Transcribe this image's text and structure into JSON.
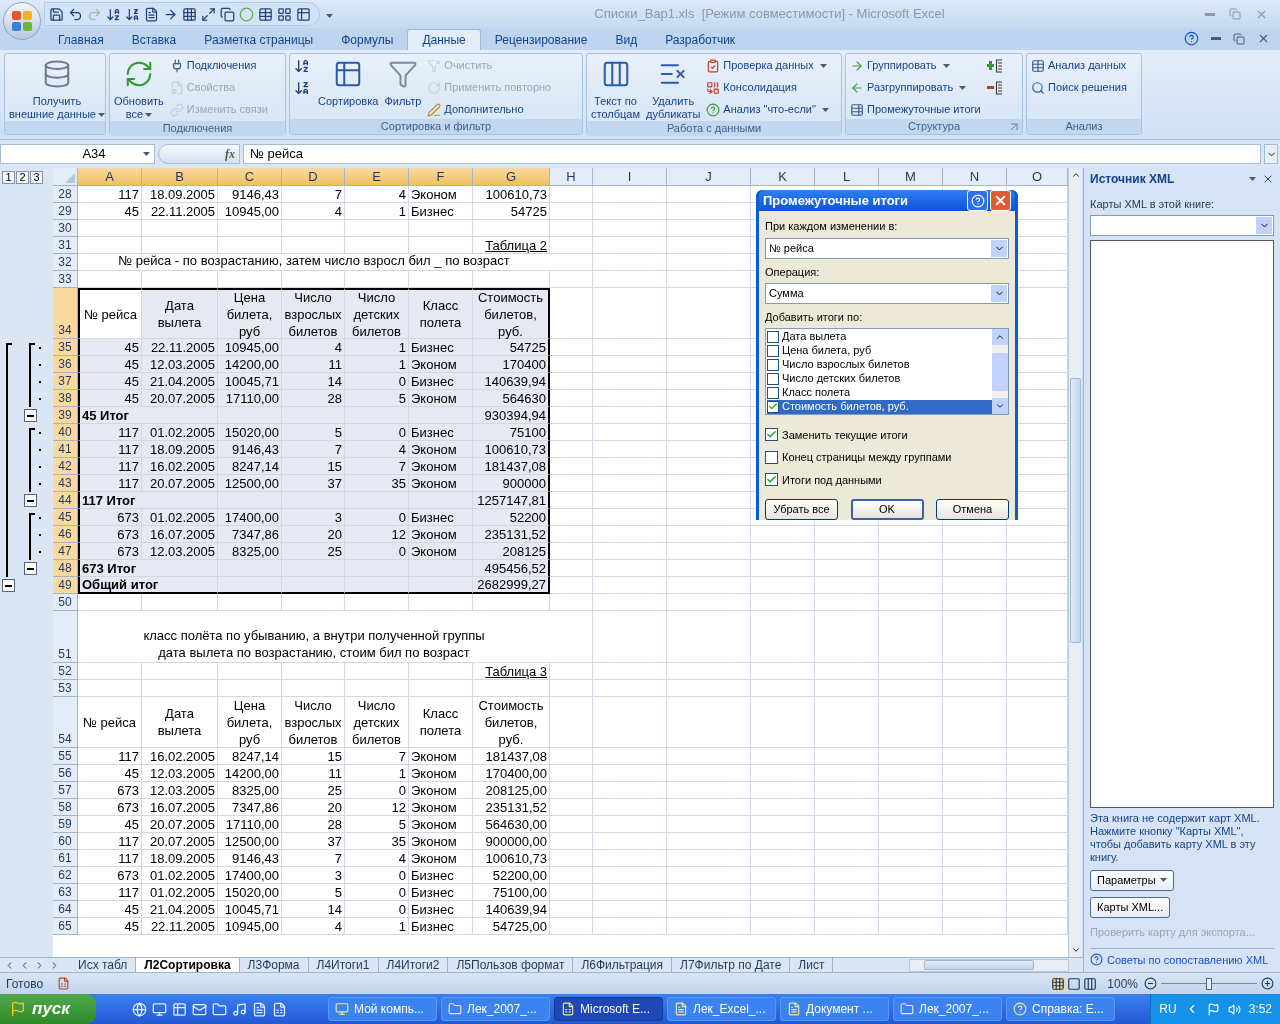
{
  "window": {
    "title": "Списки_Вар1.xls  [Режим совместимости] - Microsoft Excel"
  },
  "ribbon": {
    "tabs": [
      {
        "label": "Главная",
        "selected": false
      },
      {
        "label": "Вставка",
        "selected": false
      },
      {
        "label": "Разметка страницы",
        "selected": false
      },
      {
        "label": "Формулы",
        "selected": false
      },
      {
        "label": "Данные",
        "selected": true
      },
      {
        "label": "Рецензирование",
        "selected": false
      },
      {
        "label": "Вид",
        "selected": false
      },
      {
        "label": "Разработчик",
        "selected": false
      }
    ],
    "groups": [
      {
        "items": [
          {
            "kind": "large",
            "lines": [
              "Получить",
              "внешние данные"
            ],
            "dropdown": true,
            "disabled": false
          }
        ]
      },
      {
        "label": "Подключения",
        "items": [
          {
            "kind": "large",
            "lines": [
              "Обновить",
              "все"
            ],
            "dropdown": true,
            "disabled": false
          },
          {
            "kind": "small",
            "label": "Подключения",
            "dropdown": false,
            "disabled": false
          },
          {
            "kind": "small",
            "label": "Свойства",
            "dropdown": false,
            "disabled": true
          },
          {
            "kind": "small",
            "label": "Изменить связи",
            "dropdown": false,
            "disabled": true
          }
        ]
      },
      {
        "label": "Сортировка и фильтр",
        "items": [
          {
            "kind": "icon"
          },
          {
            "kind": "icon"
          },
          {
            "kind": "large",
            "lines": [
              "Сортировка"
            ],
            "dropdown": false,
            "disabled": false
          },
          {
            "kind": "large",
            "lines": [
              "Фильтр"
            ],
            "dropdown": false,
            "disabled": false
          },
          {
            "kind": "small",
            "label": "Очистить",
            "dropdown": false,
            "disabled": true
          },
          {
            "kind": "small",
            "label": "Применить повторно",
            "dropdown": false,
            "disabled": true
          },
          {
            "kind": "small",
            "label": "Дополнительно",
            "dropdown": false,
            "disabled": false
          }
        ]
      },
      {
        "label": "Работа с данными",
        "items": [
          {
            "kind": "large",
            "lines": [
              "Текст по",
              "столбцам"
            ],
            "dropdown": false,
            "disabled": false
          },
          {
            "kind": "large",
            "lines": [
              "Удалить",
              "дубликаты"
            ],
            "dropdown": false,
            "disabled": false
          },
          {
            "kind": "small",
            "label": "Проверка данных",
            "dropdown": true,
            "disabled": false
          },
          {
            "kind": "small",
            "label": "Консолидация",
            "dropdown": false,
            "disabled": false
          },
          {
            "kind": "small",
            "label": "Анализ \"что-если\"",
            "dropdown": true,
            "disabled": false
          }
        ]
      },
      {
        "label": "Структура",
        "launcher": true,
        "items": [
          {
            "kind": "small",
            "label": "Группировать",
            "dropdown": true,
            "disabled": false
          },
          {
            "kind": "small",
            "label": "Разгруппировать",
            "dropdown": true,
            "disabled": false
          },
          {
            "kind": "small",
            "label": "Промежуточные итоги",
            "dropdown": false,
            "disabled": false
          },
          {
            "kind": "icon"
          },
          {
            "kind": "icon"
          }
        ]
      },
      {
        "label": "Анализ",
        "items": [
          {
            "kind": "small",
            "label": "Анализ данных",
            "dropdown": false,
            "disabled": false
          },
          {
            "kind": "small",
            "label": "Поиск решения",
            "dropdown": false,
            "disabled": false
          }
        ]
      }
    ]
  },
  "formula_bar": {
    "name_box": "A34",
    "fx": "fx",
    "content": "№ рейса"
  },
  "sheet": {
    "outline_levels": [
      "1",
      "2",
      "3"
    ],
    "columns": [
      {
        "label": "A",
        "selected": true
      },
      {
        "label": "B",
        "selected": true
      },
      {
        "label": "C",
        "selected": true
      },
      {
        "label": "D",
        "selected": true
      },
      {
        "label": "E",
        "selected": true
      },
      {
        "label": "F",
        "selected": true
      },
      {
        "label": "G",
        "selected": true
      },
      {
        "label": "H",
        "selected": false
      },
      {
        "label": "I",
        "selected": false
      },
      {
        "label": "J",
        "selected": false
      },
      {
        "label": "K",
        "selected": false
      },
      {
        "label": "L",
        "selected": false
      },
      {
        "label": "M",
        "selected": false
      },
      {
        "label": "N",
        "selected": false
      },
      {
        "label": "O",
        "selected": false
      }
    ],
    "rows": [
      {
        "number": "28",
        "kind": "data",
        "selected": false,
        "cells": [
          "117",
          "18.09.2005",
          "9146,43",
          "7",
          "4",
          "Эконом",
          "100610,73"
        ]
      },
      {
        "number": "29",
        "kind": "data",
        "selected": false,
        "cells": [
          "45",
          "22.11.2005",
          "10945,00",
          "4",
          "1",
          "Бизнес",
          "54725"
        ]
      },
      {
        "number": "30",
        "kind": "empty",
        "selected": false
      },
      {
        "number": "31",
        "kind": "caption",
        "selected": false,
        "text": "Таблица 2"
      },
      {
        "number": "32",
        "kind": "note",
        "selected": false,
        "lines": [
          "№ рейса - по возрастанию, затем число взросл бил _ по возраст"
        ]
      },
      {
        "number": "33",
        "kind": "empty",
        "selected": false
      },
      {
        "number": "34",
        "kind": "header",
        "selected": true,
        "cells": [
          "№ рейса",
          "Дата вылета",
          "Цена билета, руб",
          "Число взрослых билетов",
          "Число детских билетов",
          "Класс полета",
          "Стоимость билетов, руб."
        ]
      },
      {
        "number": "35",
        "kind": "detail",
        "selected": true,
        "cells": [
          "45",
          "22.11.2005",
          "10945,00",
          "4",
          "1",
          "Бизнес",
          "54725"
        ]
      },
      {
        "number": "36",
        "kind": "detail",
        "selected": true,
        "cells": [
          "45",
          "12.03.2005",
          "14200,00",
          "11",
          "1",
          "Эконом",
          "170400"
        ]
      },
      {
        "number": "37",
        "kind": "detail",
        "selected": true,
        "cells": [
          "45",
          "21.04.2005",
          "10045,71",
          "14",
          "0",
          "Бизнес",
          "140639,94"
        ]
      },
      {
        "number": "38",
        "kind": "detail",
        "selected": true,
        "cells": [
          "45",
          "20.07.2005",
          "17110,00",
          "28",
          "5",
          "Эконом",
          "564630"
        ]
      },
      {
        "number": "39",
        "kind": "subtotal",
        "selected": true,
        "label": "45 Итог",
        "total": "930394,94"
      },
      {
        "number": "40",
        "kind": "detail",
        "selected": true,
        "cells": [
          "117",
          "01.02.2005",
          "15020,00",
          "5",
          "0",
          "Бизнес",
          "75100"
        ]
      },
      {
        "number": "41",
        "kind": "detail",
        "selected": true,
        "cells": [
          "117",
          "18.09.2005",
          "9146,43",
          "7",
          "4",
          "Эконом",
          "100610,73"
        ]
      },
      {
        "number": "42",
        "kind": "detail",
        "selected": true,
        "cells": [
          "117",
          "16.02.2005",
          "8247,14",
          "15",
          "7",
          "Эконом",
          "181437,08"
        ]
      },
      {
        "number": "43",
        "kind": "detail",
        "selected": true,
        "cells": [
          "117",
          "20.07.2005",
          "12500,00",
          "37",
          "35",
          "Эконом",
          "900000"
        ]
      },
      {
        "number": "44",
        "kind": "subtotal",
        "selected": true,
        "label": "117 Итог",
        "total": "1257147,81"
      },
      {
        "number": "45",
        "kind": "detail",
        "selected": true,
        "cells": [
          "673",
          "01.02.2005",
          "17400,00",
          "3",
          "0",
          "Бизнес",
          "52200"
        ]
      },
      {
        "number": "46",
        "kind": "detail",
        "selected": true,
        "cells": [
          "673",
          "16.07.2005",
          "7347,86",
          "20",
          "12",
          "Эконом",
          "235131,52"
        ]
      },
      {
        "number": "47",
        "kind": "detail",
        "selected": true,
        "cells": [
          "673",
          "12.03.2005",
          "8325,00",
          "25",
          "0",
          "Эконом",
          "208125"
        ]
      },
      {
        "number": "48",
        "kind": "subtotal",
        "selected": true,
        "label": "673 Итог",
        "total": "495456,52"
      },
      {
        "number": "49",
        "kind": "grand_total",
        "selected": true,
        "label": "Общий итог",
        "total": "2682999,27"
      },
      {
        "number": "50",
        "kind": "empty",
        "selected": false
      },
      {
        "number": "51",
        "kind": "note",
        "selected": false,
        "lines": [
          "класс полёта по убыванию, а внутри полученной группы",
          "дата вылета по возрастанию, стоим бил по возраст"
        ]
      },
      {
        "number": "52",
        "kind": "caption",
        "selected": false,
        "text": "Таблица 3"
      },
      {
        "number": "53",
        "kind": "empty",
        "selected": false
      },
      {
        "number": "54",
        "kind": "header",
        "selected": false,
        "cells": [
          "№ рейса",
          "Дата вылета",
          "Цена билета, руб",
          "Число взрослых билетов",
          "Число детских билетов",
          "Класс полета",
          "Стоимость билетов, руб."
        ]
      },
      {
        "number": "55",
        "kind": "data",
        "selected": false,
        "cells": [
          "117",
          "16.02.2005",
          "8247,14",
          "15",
          "7",
          "Эконом",
          "181437,08"
        ]
      },
      {
        "number": "56",
        "kind": "data",
        "selected": false,
        "cells": [
          "45",
          "12.03.2005",
          "14200,00",
          "11",
          "1",
          "Эконом",
          "170400,00"
        ]
      },
      {
        "number": "57",
        "kind": "data",
        "selected": false,
        "cells": [
          "673",
          "12.03.2005",
          "8325,00",
          "25",
          "0",
          "Эконом",
          "208125,00"
        ]
      },
      {
        "number": "58",
        "kind": "data",
        "selected": false,
        "cells": [
          "673",
          "16.07.2005",
          "7347,86",
          "20",
          "12",
          "Эконом",
          "235131,52"
        ]
      },
      {
        "number": "59",
        "kind": "data",
        "selected": false,
        "cells": [
          "45",
          "20.07.2005",
          "17110,00",
          "28",
          "5",
          "Эконом",
          "564630,00"
        ]
      },
      {
        "number": "60",
        "kind": "data",
        "selected": false,
        "cells": [
          "117",
          "20.07.2005",
          "12500,00",
          "37",
          "35",
          "Эконом",
          "900000,00"
        ]
      },
      {
        "number": "61",
        "kind": "data",
        "selected": false,
        "cells": [
          "117",
          "18.09.2005",
          "9146,43",
          "7",
          "4",
          "Эконом",
          "100610,73"
        ]
      },
      {
        "number": "62",
        "kind": "data",
        "selected": false,
        "cells": [
          "673",
          "01.02.2005",
          "17400,00",
          "3",
          "0",
          "Бизнес",
          "52200,00"
        ]
      },
      {
        "number": "63",
        "kind": "data",
        "selected": false,
        "cells": [
          "117",
          "01.02.2005",
          "15020,00",
          "5",
          "0",
          "Бизнес",
          "75100,00"
        ]
      },
      {
        "number": "64",
        "kind": "data",
        "selected": false,
        "cells": [
          "45",
          "21.04.2005",
          "10045,71",
          "14",
          "0",
          "Бизнес",
          "140639,94"
        ]
      },
      {
        "number": "65",
        "kind": "data",
        "selected": false,
        "cells": [
          "45",
          "22.11.2005",
          "10945,00",
          "4",
          "1",
          "Бизнес",
          "54725,00"
        ]
      }
    ],
    "tabs": [
      {
        "label": "Исх табл",
        "selected": false
      },
      {
        "label": "Л2Сортировка",
        "selected": true
      },
      {
        "label": "Л3Форма",
        "selected": false
      },
      {
        "label": "Л4Итоги1",
        "selected": false
      },
      {
        "label": "Л4Итоги2",
        "selected": false
      },
      {
        "label": "Л5Пользов формат",
        "selected": false
      },
      {
        "label": "Л6Фильтрация",
        "selected": false
      },
      {
        "label": "Л7Фильтр по Дате",
        "selected": false
      },
      {
        "label": "Лист",
        "selected": false
      }
    ]
  },
  "dialog": {
    "title": "Промежуточные итоги",
    "group_by_label": "При каждом изменении в:",
    "group_by": "№ рейса",
    "operation_label": "Операция:",
    "operation": "Сумма",
    "add_to_label": "Добавить итоги по:",
    "add_to": [
      {
        "label": "Дата вылета",
        "checked": false,
        "selected": false
      },
      {
        "label": "Цена билета, руб",
        "checked": false,
        "selected": false
      },
      {
        "label": "Число взрослых билетов",
        "checked": false,
        "selected": false
      },
      {
        "label": "Число детских билетов",
        "checked": false,
        "selected": false
      },
      {
        "label": "Класс полета",
        "checked": false,
        "selected": false
      },
      {
        "label": "Стоимость билетов, руб.",
        "checked": true,
        "selected": true
      }
    ],
    "options": [
      {
        "label": "Заменить текущие итоги",
        "checked": true
      },
      {
        "label": "Конец страницы между группами",
        "checked": false
      },
      {
        "label": "Итоги под данными",
        "checked": true
      }
    ],
    "buttons": [
      {
        "label": "Убрать все",
        "default": false
      },
      {
        "label": "OK",
        "default": true
      },
      {
        "label": "Отмена",
        "default": false
      }
    ]
  },
  "xml_pane": {
    "title": "Источник XML",
    "maps_label": "Карты XML в этой книге:",
    "message": "Эта книга не содержит карт XML. Нажмите кнопку \"Карты XML\", чтобы добавить карту XML в эту книгу.",
    "buttons": [
      {
        "label": "Параметры",
        "dropdown": true
      },
      {
        "label": "Карты XML...",
        "dropdown": false
      }
    ],
    "verify_link": {
      "label": "Проверить карту для экспорта...",
      "disabled": true
    },
    "help_link": "Советы по сопоставлению XML"
  },
  "status_bar": {
    "status": "Готово",
    "zoom": "100%",
    "zoom_slider": {
      "level": 0.5
    }
  },
  "taskbar": {
    "start": "пуск",
    "tasks": [
      {
        "label": "Мой компь...",
        "selected": false
      },
      {
        "label": "Лек_2007_...",
        "selected": false
      },
      {
        "label": "Microsoft E...",
        "selected": true
      },
      {
        "label": "Лек_Excel_...",
        "selected": false
      },
      {
        "label": "Документ ...",
        "selected": false
      },
      {
        "label": "Лек_2007_...",
        "selected": false
      },
      {
        "label": "Справка: E...",
        "selected": false
      }
    ],
    "language": "RU",
    "time": "3:52"
  }
}
